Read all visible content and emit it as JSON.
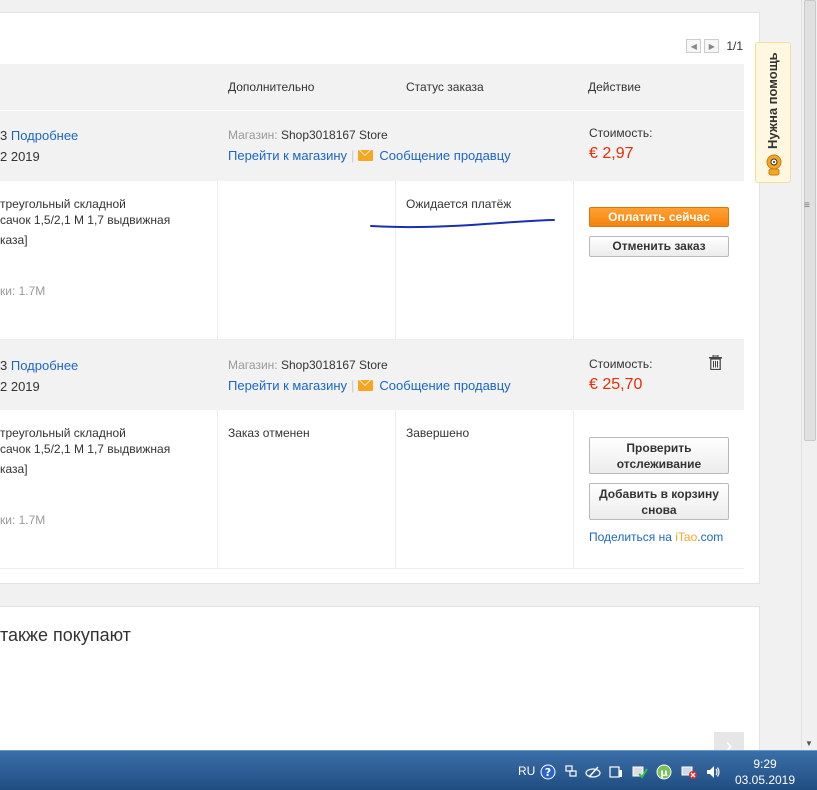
{
  "pager": {
    "prev": "◀",
    "next": "▶",
    "text": "1/1"
  },
  "columns": {
    "additional": "Дополнительно",
    "status": "Статус заказа",
    "action": "Действие"
  },
  "orders": [
    {
      "id_suffix": "3",
      "details_link": "Подробнее",
      "date_suffix": "2 2019",
      "store_label": "Магазин:",
      "store_name": "Shop3018167 Store",
      "go_to_store": "Перейти к магазину",
      "separator": "|",
      "message_seller": "Сообщение продавцу",
      "cost_label": "Стоимость:",
      "cost": "€ 2,97",
      "product_line1": "треугольный складной",
      "product_line2": "сачок 1,5/2,1 М 1,7 выдвижная",
      "product_line3": "каза]",
      "product_attr": "ки: 1.7M",
      "additional": "",
      "status": "Ожидается платёж",
      "primary_button": "Оплатить сейчас",
      "secondary_button": "Отменить заказ"
    },
    {
      "id_suffix": "3",
      "details_link": "Подробнее",
      "date_suffix": "2 2019",
      "store_label": "Магазин:",
      "store_name": "Shop3018167 Store",
      "go_to_store": "Перейти к магазину",
      "separator": "|",
      "message_seller": "Сообщение продавцу",
      "cost_label": "Стоимость:",
      "cost": "€ 25,70",
      "product_line1": "треугольный складной",
      "product_line2": "сачок 1,5/2,1 М 1,7 выдвижная",
      "product_line3": "каза]",
      "product_attr": "ки: 1.7M",
      "additional": "Заказ отменен",
      "status": "Завершено",
      "track_button_l1": "Проверить",
      "track_button_l2": "отслеживание",
      "add_cart_button_l1": "Добавить в корзину",
      "add_cart_button_l2": "снова",
      "share_prefix": "Поделиться на ",
      "share_brand_i": "i",
      "share_brand_tao": "Tao",
      "share_brand_com": ".com"
    }
  ],
  "recommend": {
    "title": "также покупают",
    "arrow": "›"
  },
  "help_tab": "Нужна помощь",
  "taskbar": {
    "lang": "RU",
    "time": "9:29",
    "date": "03.05.2019"
  },
  "colors": {
    "accent_orange": "#f5820b",
    "link_blue": "#1a66c8",
    "price_red": "#e62e04",
    "annotation_ink": "#1a2fb4"
  }
}
